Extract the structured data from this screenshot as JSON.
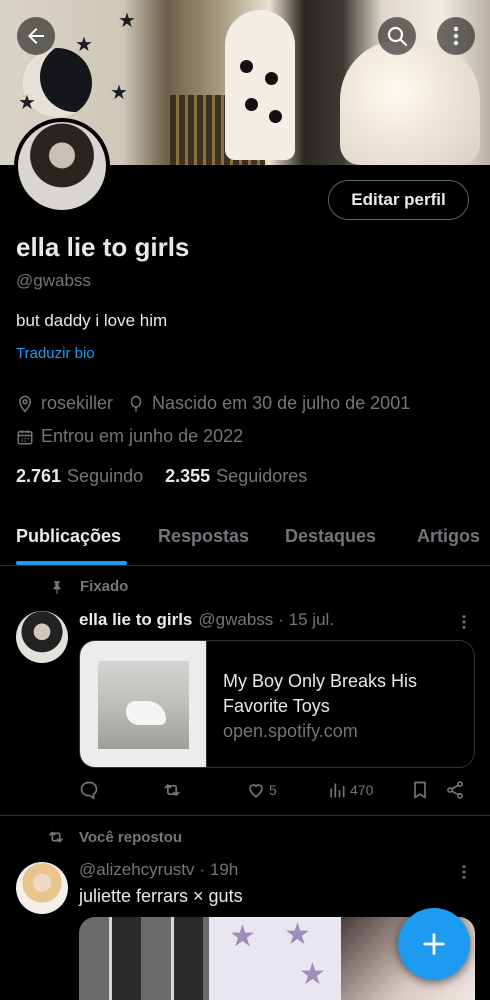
{
  "profile": {
    "display_name": "ella lie to girls",
    "handle": "@gwabss",
    "bio": "but daddy i love him",
    "translate_bio": "Traduzir bio",
    "location": "rosekiller",
    "birthday": "Nascido em 30 de julho de 2001",
    "joined": "Entrou em junho de 2022",
    "following_count": "2.761",
    "following_label": "Seguindo",
    "followers_count": "2.355",
    "followers_label": "Seguidores",
    "edit_button": "Editar perfil"
  },
  "tabs": [
    {
      "label": "Publicações",
      "active": true
    },
    {
      "label": "Respostas",
      "active": false
    },
    {
      "label": "Destaques",
      "active": false
    },
    {
      "label": "Artigos",
      "active": false
    }
  ],
  "posts": [
    {
      "context_label": "Fixado",
      "author": "ella lie to girls",
      "handle": "@gwabss",
      "time": "· 15 jul.",
      "card": {
        "title": "My Boy Only Breaks His Favorite Toys",
        "domain": "open.spotify.com"
      },
      "likes": "5",
      "views": "470"
    },
    {
      "context_label": "Você repostou",
      "handle": "@alizehcyrustv",
      "time": "· 19h",
      "text": "juliette ferrars × guts"
    }
  ],
  "icons": {
    "back": "arrow-left-icon",
    "search": "search-icon",
    "more": "more-vertical-icon",
    "compose": "plus-icon"
  },
  "colors": {
    "accent": "#1d9bf0",
    "background": "#000000",
    "muted": "#71767b",
    "border": "#2f3336"
  }
}
